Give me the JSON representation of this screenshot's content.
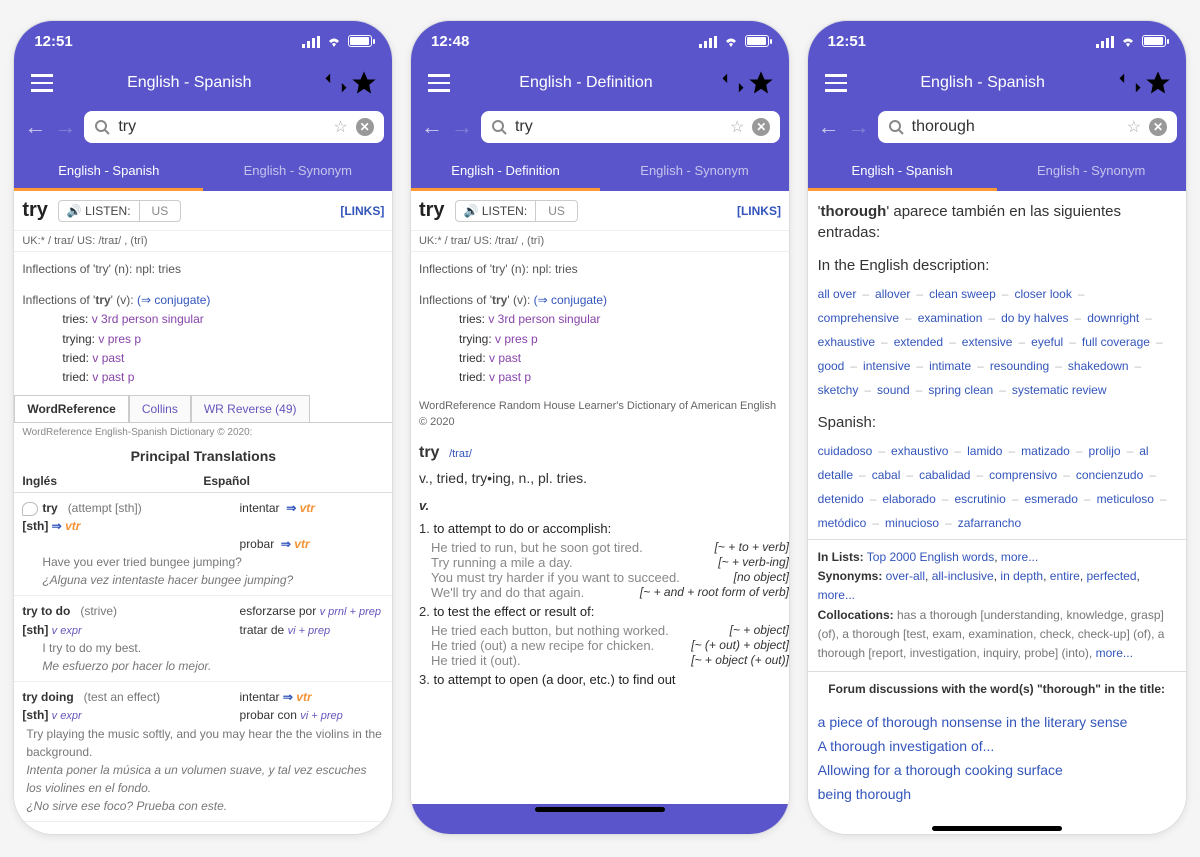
{
  "colors": {
    "primary": "#5a55ca",
    "accent": "#ff9933",
    "link": "#3355bb"
  },
  "screens": [
    {
      "status_time": "12:51",
      "title": "English - Spanish",
      "search_value": "try",
      "tabs": [
        {
          "label": "English - Spanish",
          "active": true
        },
        {
          "label": "English - Synonym",
          "active": false
        }
      ],
      "entry": {
        "word": "try",
        "listen_label": "🔊 LISTEN:",
        "listen_locale": "US",
        "links_label": "[LINKS]",
        "pron": "UK:* / traɪ/  US: /traɪ/ , (trī)",
        "inflections_noun": "Inflections of 'try' (n): npl: tries",
        "inflections_verb_head": "Inflections of 'try' (v): (⇒ conjugate)",
        "inflections_verb_lines": [
          {
            "form": "tries:",
            "desc": "v 3rd person singular"
          },
          {
            "form": "trying:",
            "desc": "v pres p"
          },
          {
            "form": "tried:",
            "desc": "v past"
          },
          {
            "form": "tried:",
            "desc": "v past p"
          }
        ],
        "source_tabs": [
          {
            "label": "WordReference",
            "active": true
          },
          {
            "label": "Collins",
            "active": false
          },
          {
            "label": "WR Reverse (49)",
            "active": false
          }
        ],
        "copyright": "WordReference English-Spanish Dictionary © 2020:",
        "section_title": "Principal Translations",
        "col_en": "Inglés",
        "col_es": "Español",
        "rows": [
          {
            "en_word": "try",
            "en_sense": "(attempt [sth])",
            "en_cat": "[sth]",
            "en_pos": "vtr",
            "es1": "intentar",
            "es1_pos": "vtr",
            "es2": "probar",
            "es2_pos": "vtr",
            "ex_en": "Have you ever tried bungee jumping?",
            "ex_es": "¿Alguna vez intentaste hacer bungee jumping?"
          },
          {
            "en_word": "try to do",
            "en_cat2": "[sth]",
            "en_pos": "v expr",
            "en_sense": "(strive)",
            "es1": "esforzarse por",
            "es1_pos": "v prnl + prep",
            "es2": "tratar de",
            "es2_pos": "vi + prep",
            "ex_en": "I try to do my best.",
            "ex_es": "Me esfuerzo por hacer lo mejor."
          },
          {
            "en_word": "try doing",
            "en_cat2": "[sth]",
            "en_pos": "v expr",
            "en_sense": "(test an effect)",
            "es1": "intentar",
            "es1_pos": "vtr",
            "es2": "probar con",
            "es2_pos": "vi + prep",
            "ex_en": "Try playing the music softly, and you may hear the the violins in the background.",
            "ex_es": "Intenta poner la música a un volumen suave, y tal vez escuches los violines en el fondo.",
            "ex_es2": "¿No sirve ese foco? Prueba con este."
          }
        ]
      }
    },
    {
      "status_time": "12:48",
      "title": "English - Definition",
      "search_value": "try",
      "tabs": [
        {
          "label": "English - Definition",
          "active": true
        },
        {
          "label": "English - Synonym",
          "active": false
        }
      ],
      "entry": {
        "word": "try",
        "listen_label": "🔊 LISTEN:",
        "listen_locale": "US",
        "links_label": "[LINKS]",
        "pron": "UK:* / traɪ/  US: /traɪ/ , (trī)",
        "inflections_noun": "Inflections of 'try' (n): npl: tries",
        "inflections_verb_head": "Inflections of 'try' (v): (⇒ conjugate)",
        "inflections_verb_lines": [
          {
            "form": "tries:",
            "desc": "v 3rd person singular"
          },
          {
            "form": "trying:",
            "desc": "v pres p"
          },
          {
            "form": "tried:",
            "desc": "v past"
          },
          {
            "form": "tried:",
            "desc": "v past p"
          }
        ],
        "source": "WordReference Random House Learner's Dictionary of American English © 2020",
        "def_word": "try",
        "def_pron": "/traɪ/",
        "def_forms": "v., tried, try•ing, n., pl. tries.",
        "pos": "v.",
        "defs": [
          {
            "num": "1.",
            "text": "to attempt to do or accomplish:",
            "examples": [
              {
                "ex": "He tried to run, but he soon got tired.",
                "pat": "[~ + to + verb]"
              },
              {
                "ex": "Try running a mile a day.",
                "pat": "[~ + verb-ing]"
              },
              {
                "ex": "You must try harder if you want to succeed.",
                "pat": "[no object]"
              },
              {
                "ex": "We'll try and do that again.",
                "pat": "[~ + and + root form of verb]"
              }
            ]
          },
          {
            "num": "2.",
            "text": "to test the effect or result of:",
            "examples": [
              {
                "ex": "He tried each button, but nothing worked.",
                "pat": "[~ + object]"
              },
              {
                "ex": "He tried (out) a new recipe for chicken.",
                "pat": "[~ (+ out) + object]"
              },
              {
                "ex": "He tried it (out).",
                "pat": "[~ + object (+ out)]"
              }
            ]
          },
          {
            "num": "3.",
            "text": "to attempt to open (a door, etc.) to find out",
            "examples": []
          }
        ]
      }
    },
    {
      "status_time": "12:51",
      "title": "English - Spanish",
      "search_value": "thorough",
      "tabs": [
        {
          "label": "English - Spanish",
          "active": true
        },
        {
          "label": "English - Synonym",
          "active": false
        }
      ],
      "related": {
        "intro_word": "thorough",
        "intro_rest": "aparece también en las siguientes entradas:",
        "eng_sub": "In the English description:",
        "eng_links": [
          "all over",
          "allover",
          "clean sweep",
          "closer look",
          "comprehensive",
          "examination",
          "do by halves",
          "downright",
          "exhaustive",
          "extended",
          "extensive",
          "eyeful",
          "full coverage",
          "good",
          "intensive",
          "intimate",
          "resounding",
          "shakedown",
          "sketchy",
          "sound",
          "spring clean",
          "systematic review"
        ],
        "es_sub": "Spanish:",
        "es_links": [
          "cuidadoso",
          "exhaustivo",
          "lamido",
          "matizado",
          "prolijo",
          "al detalle",
          "cabal",
          "cabalidad",
          "comprensivo",
          "concienzudo",
          "detenido",
          "elaborado",
          "escrutinio",
          "esmerado",
          "meticuloso",
          "metódico",
          "minucioso",
          "zafarrancho"
        ],
        "lists_label": "In Lists:",
        "lists_links": [
          "Top 2000 English words",
          "more..."
        ],
        "syn_label": "Synonyms:",
        "syn_links": [
          "over-all",
          "all-inclusive",
          "in depth",
          "entire",
          "perfected",
          "more..."
        ],
        "coll_label": "Collocations:",
        "coll_text": "has a thorough [understanding, knowledge, grasp] (of), a thorough [test, exam, examination, check, check-up] (of), a thorough [report, investigation, inquiry, probe] (into),",
        "coll_more": "more...",
        "forum_head": "Forum discussions with the word(s) \"thorough\" in the title:",
        "forum_links": [
          "a piece of thorough nonsense in the literary sense",
          "A thorough investigation of...",
          "Allowing for a thorough cooking surface",
          "being thorough"
        ]
      }
    }
  ]
}
